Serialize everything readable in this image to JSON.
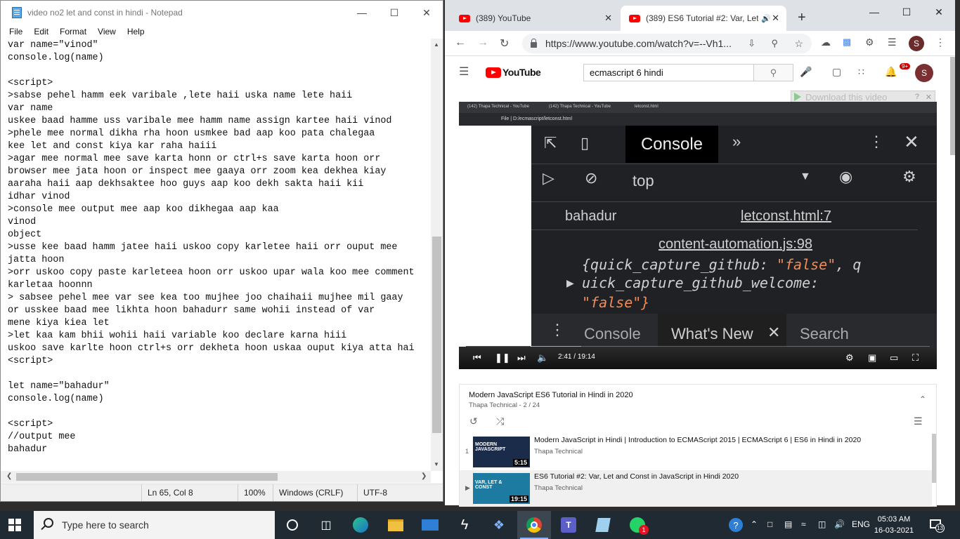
{
  "notepad": {
    "title": "video no2 let and const in hindi - Notepad",
    "menu": [
      "File",
      "Edit",
      "Format",
      "View",
      "Help"
    ],
    "content": "var name=\"vinod\"\nconsole.log(name)\n\n<script>\n>sabse pehel hamm eek varibale ,lete haii uska name lete haii\nvar name\nuskee baad hamme uss varibale mee hamm name assign kartee haii vinod\n>phele mee normal dikha rha hoon usmkee bad aap koo pata chalegaa\nkee let and const kiya kar raha haiii\n>agar mee normal mee save karta honn or ctrl+s save karta hoon orr\nbrowser mee jata hoon or inspect mee gaaya orr zoom kea dekhea kiay\naaraha haii aap dekhsaktee hoo guys aap koo dekh sakta haii kii\nidhar vinod\n>console mee output mee aap koo dikhegaa aap kaa\nvinod\nobject\n>usse kee baad hamm jatee haii uskoo copy karletee haii orr ouput mee\njatta hoon\n>orr uskoo copy paste karleteea hoon orr uskoo upar wala koo mee comment\nkarletaa hoonnn\n> sabsee pehel mee var see kea too mujhee joo chaihaii mujhee mil gaay\nor usskee baad mee likhta hoon bahadurr same wohii instead of var\nmene kiya kiea let\n>let kaa kam bhii wohii haii variable koo declare karna hiii\nuskoo save karlte hoon ctrl+s orr dekheta hoon uskaa ouput kiya atta hai\n<script>\n\nlet name=\"bahadur\"\nconsole.log(name)\n\n<script>\n//output mee\nbahadur",
    "status": {
      "position": "Ln 65, Col 8",
      "zoom": "100%",
      "line_ending": "Windows (CRLF)",
      "encoding": "UTF-8"
    }
  },
  "chrome": {
    "tabs": [
      {
        "label": "(389) YouTube",
        "active": false
      },
      {
        "label": "(389) ES6 Tutorial #2: Var, Let",
        "active": true
      }
    ],
    "url": "https://www.youtube.com/watch?v=--Vh1...",
    "profile_initial": "S"
  },
  "youtube": {
    "logo_text": "YouTube",
    "search_value": "ecmascript 6 hindi",
    "notification_count": "9+",
    "avatar_initial": "S",
    "download_button": "Download this video"
  },
  "video": {
    "inner_tabs": [
      "(142) Thapa Technical - YouTube",
      "(142) Thapa Technical - YouTube",
      "letconst.html"
    ],
    "inner_address": "File | D:/ecmascript/letconst.html",
    "devtools": {
      "tab_console": "Console",
      "context": "top",
      "log1_value": "bahadur",
      "log1_source": "letconst.html:7",
      "log2_source": "content-automation.js:98",
      "log2_line1_key": "{quick_capture_github:",
      "log2_line1_val": "\"false\"",
      "log2_line1_tail": ", q",
      "log2_line2": "uick_capture_github_welcome:",
      "log2_line3": "\"false\"}",
      "drawer_tabs": [
        "Console",
        "What's New",
        "Search"
      ]
    },
    "time_current": "2:41",
    "time_total": "19:14",
    "progress_fraction": 0.14
  },
  "playlist": {
    "title": "Modern JavaScript ES6 Tutorial in Hindi in 2020",
    "subtitle": "Thapa Technical - 2 / 24",
    "items": [
      {
        "index": "1",
        "title": "Modern JavaScript in Hindi | Introduction to ECMAScript 2015 | ECMAScript 6 | ES6 in Hindi in 2020",
        "channel": "Thapa Technical",
        "duration": "5:15",
        "thumb_text": "MODERN JAVASCRIPT"
      },
      {
        "index": "▶",
        "title": "ES6 Tutorial #2: Var, Let and Const in JavaScript in Hindi 2020",
        "channel": "Thapa Technical",
        "duration": "19:15",
        "thumb_text": "VAR, LET & CONST"
      }
    ]
  },
  "taskbar": {
    "search_placeholder": "Type here to search",
    "language": "ENG",
    "time": "05:03 AM",
    "date": "16-03-2021",
    "notification_count": "13",
    "whatsapp_badge": "1"
  },
  "colors": {
    "youtube_red": "#ff0000",
    "taskbar_bg": "#1f2a33",
    "devtools_bg": "#202124"
  }
}
